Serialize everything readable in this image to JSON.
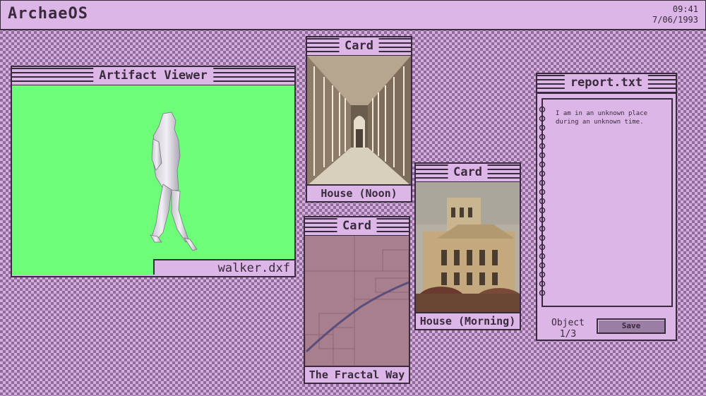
{
  "menubar": {
    "app_title": "ArchaeOS",
    "time": "09:41",
    "date": "7/06/1993"
  },
  "viewer": {
    "title": "Artifact Viewer",
    "filename": "walker.dxf",
    "canvas_color": "#6dfd78"
  },
  "cards": [
    {
      "title": "Card",
      "caption": "House (Noon)"
    },
    {
      "title": "Card",
      "caption": "House (Morning)"
    },
    {
      "title": "Card",
      "caption": "The Fractal Way"
    }
  ],
  "report": {
    "title": "report.txt",
    "text": "I am in an unknown place\nduring an unknown time.",
    "object_label": "Object",
    "object_count": "1/3",
    "save_label": "Save"
  },
  "colors": {
    "ink": "#3a2a3e",
    "window": "#dcb6e6",
    "pattern": "#8f6c97"
  }
}
